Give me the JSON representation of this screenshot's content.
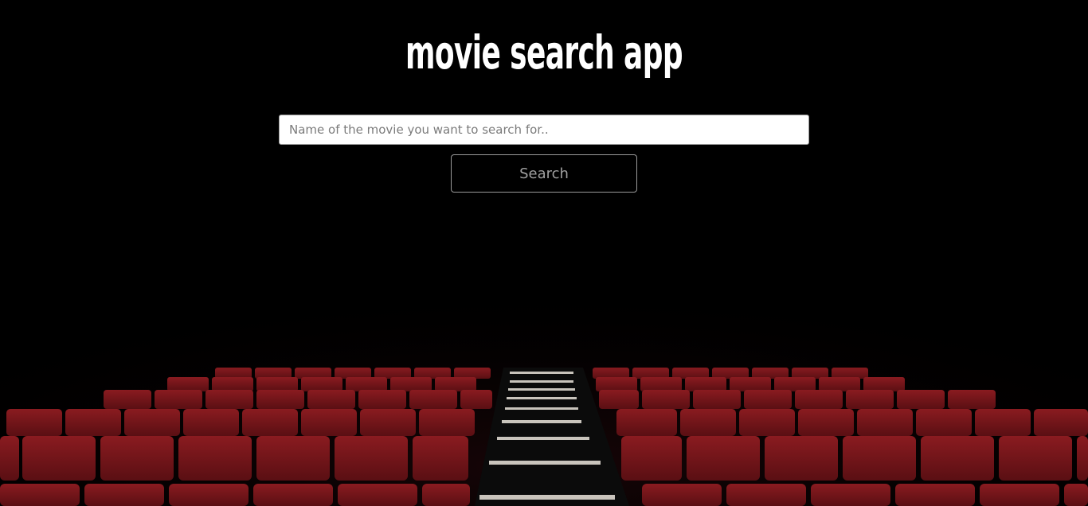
{
  "header": {
    "title": "movie search app"
  },
  "search": {
    "placeholder": "Name of the movie you want to search for..",
    "value": "",
    "button_label": "Search"
  },
  "theme": {
    "background": "#000000",
    "seat_color": "#8e1a1f",
    "title_color": "#ffffff"
  }
}
